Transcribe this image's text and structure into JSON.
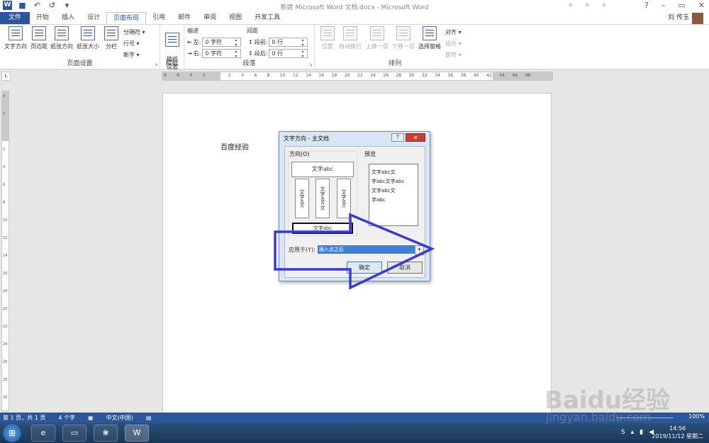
{
  "window": {
    "title": "新建 Microsoft Word 文档.docx - Microsoft Word",
    "user_name": "刘 传玉",
    "min": "–",
    "restore": "▭",
    "close": "✕",
    "help": "?"
  },
  "quick_access": {
    "undo": "↶",
    "redo": "↺",
    "more": "▾"
  },
  "tabs": [
    "文件",
    "开始",
    "插入",
    "设计",
    "页面布局",
    "引用",
    "邮件",
    "审阅",
    "视图",
    "开发工具"
  ],
  "ribbon": {
    "page_setup": {
      "label": "页面设置",
      "text_direction": "文字方向",
      "margins": "页边距",
      "orientation": "纸张方向",
      "size": "纸张大小",
      "columns": "分栏",
      "breaks": "分隔符 ▾",
      "line_numbers": "行号 ▾",
      "hyphenation": "断字 ▾"
    },
    "manuscript": {
      "label": "稿纸",
      "button": "稿纸\n设置"
    },
    "paragraph": {
      "label": "段落",
      "indent_title": "缩进",
      "spacing_title": "间距",
      "left_label": "左:",
      "right_label": "右:",
      "left_value": "0 字符",
      "right_value": "0 字符",
      "before_label": "段前:",
      "after_label": "段后:",
      "before_value": "0 行",
      "after_value": "0 行"
    },
    "arrange": {
      "label": "排列",
      "position": "位置",
      "wrap": "自动换行",
      "forward": "上移一层",
      "backward": "下移一层",
      "selection_pane": "选择窗格",
      "align": "对齐 ▾",
      "group": "组合 ▾",
      "rotate": "旋转 ▾"
    }
  },
  "ruler_ticks": [
    "8",
    "6",
    "4",
    "2",
    "",
    "2",
    "4",
    "6",
    "8",
    "10",
    "12",
    "14",
    "16",
    "18",
    "20",
    "22",
    "24",
    "26",
    "28",
    "30",
    "32",
    "34",
    "36",
    "38",
    "40",
    "42",
    "44",
    "46",
    "48"
  ],
  "vruler_ticks": [
    "4",
    "2",
    "",
    "2",
    "4",
    "6",
    "8",
    "10",
    "12",
    "14",
    "16",
    "18",
    "20",
    "22",
    "24",
    "26",
    "28",
    "30"
  ],
  "document": {
    "text": "百度经验"
  },
  "dialog": {
    "title": "文字方向 - 主文档",
    "orientation_label": "方向(O)",
    "preview_label": "预览",
    "option_horizontal": "文字abc",
    "option_vertical_1": "文字abc",
    "option_vertical_2": "文字abc文",
    "option_vertical_3": "文字abc",
    "option_rotated": "文字abc",
    "preview_lines": [
      "文字abc文",
      "字abc文字abc",
      "文字abc文",
      "字abc"
    ],
    "apply_label": "应用于(Y):",
    "apply_value": "插入点之后",
    "ok": "确定",
    "cancel": "取消"
  },
  "statusbar": {
    "page": "第 1 页，共 1 页",
    "words": "4 个字",
    "language": "中文(中国)",
    "zoom": "100%"
  },
  "taskbar": {
    "time": "14:56",
    "date": "2019/11/12 星期二",
    "ime": "S",
    "apps": [
      "ie",
      "explorer",
      "baidu",
      "word"
    ]
  },
  "watermark": {
    "brand": "Baidu经验",
    "url": "jingyan.baidu.com"
  },
  "colors": {
    "accent": "#2b579a",
    "annotation": "#3b3bc9",
    "selection": "#3e82d6"
  }
}
